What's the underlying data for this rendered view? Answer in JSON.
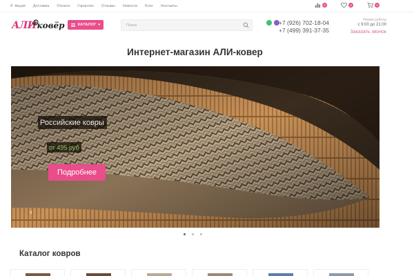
{
  "topnav": {
    "links": [
      "Акции",
      "Доставка",
      "Оплата",
      "Гарантия",
      "Отзывы",
      "Новости",
      "Блог",
      "Контакты"
    ],
    "compare_count": "0",
    "favorites_count": "0",
    "cart_count": "0"
  },
  "header": {
    "logo_part1": "АЛИ",
    "logo_part2": "ковёр",
    "catalog_button": "КАТАЛОГ",
    "search_placeholder": "Поиск",
    "phone1": "+7 (926) 702-18-04",
    "phone2": "+7 (499) 391-37-35",
    "work_label": "Режим работы",
    "work_hours": "с 9:00 до 21:00",
    "callback_link": "Заказать звонок"
  },
  "page_title": "Интернет-магазин АЛИ-ковер",
  "slider": {
    "caption": "Российские ковры",
    "price": "от 495 руб",
    "button": "Подробнее",
    "active_slide": 1,
    "slides_total": 3
  },
  "catalog": {
    "title": "Каталог ковров",
    "cards_visible": 6
  },
  "colors": {
    "accent": "#e94d8a",
    "price_green": "#8fcf55",
    "whatsapp": "#3ec46d",
    "viber": "#8e5dc7"
  },
  "icons": [
    "compare-icon",
    "heart-icon",
    "cart-icon",
    "search-icon",
    "whatsapp-icon",
    "viber-icon",
    "arrow-left-icon",
    "arrow-right-icon"
  ]
}
